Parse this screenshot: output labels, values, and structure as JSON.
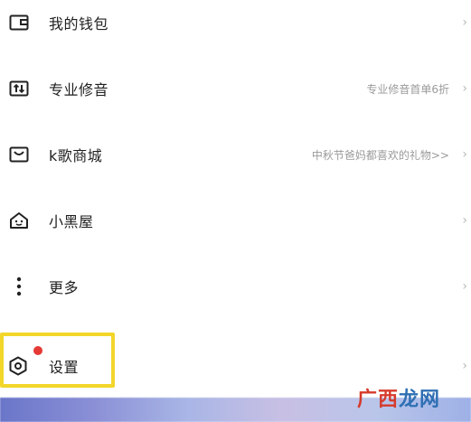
{
  "menu": {
    "items": [
      {
        "icon": "wallet-icon",
        "label": "我的钱包",
        "hint": ""
      },
      {
        "icon": "audio-edit-icon",
        "label": "专业修音",
        "hint": "专业修音首单6折"
      },
      {
        "icon": "mall-icon",
        "label": "k歌商城",
        "hint": "中秋节爸妈都喜欢的礼物>>"
      },
      {
        "icon": "house-icon",
        "label": "小黑屋",
        "hint": ""
      },
      {
        "icon": "more-vertical-icon",
        "label": "更多",
        "hint": ""
      },
      {
        "icon": "settings-icon",
        "label": "设置",
        "hint": ""
      }
    ],
    "chevron": "›"
  },
  "watermark": {
    "part1": "广西",
    "part2": "龙网"
  },
  "colors": {
    "highlight": "#f2d62a",
    "notification_dot": "#e53935"
  }
}
